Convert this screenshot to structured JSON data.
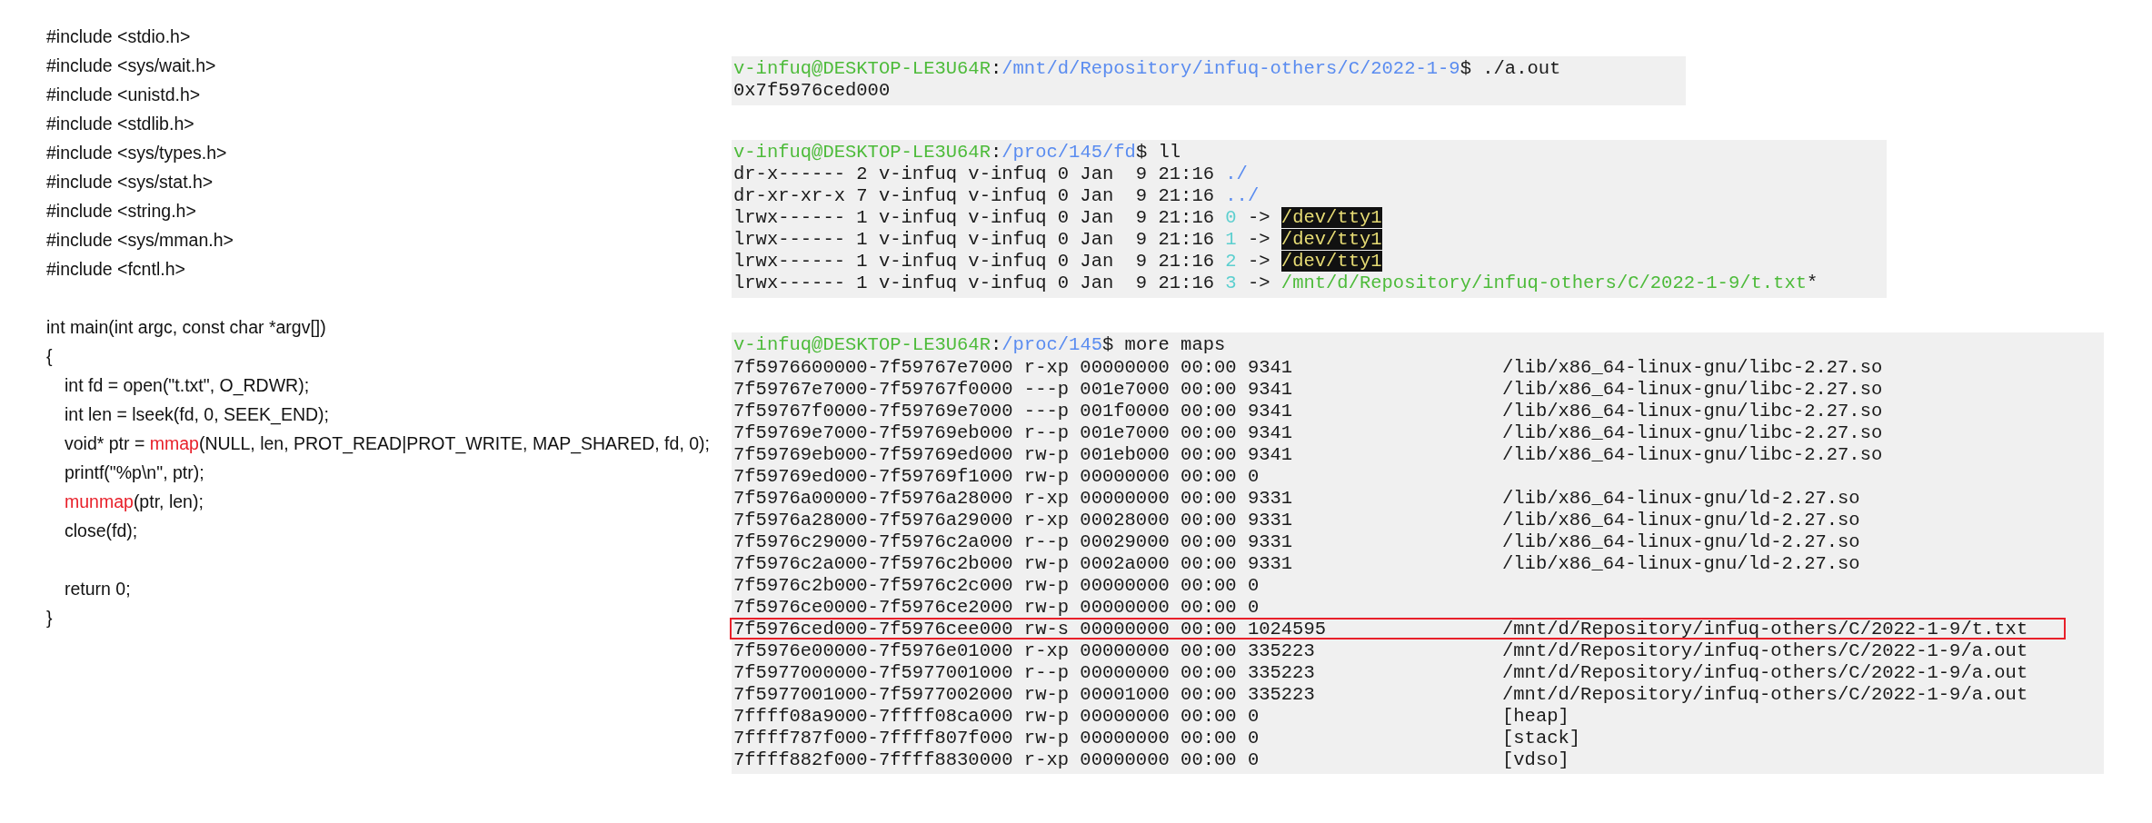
{
  "source_code": {
    "lines": [
      {
        "indented": false,
        "gap_before": false,
        "parts": [
          {
            "kind": "plain",
            "text": "#include <stdio.h>"
          }
        ]
      },
      {
        "indented": false,
        "gap_before": false,
        "parts": [
          {
            "kind": "plain",
            "text": "#include <sys/wait.h>"
          }
        ]
      },
      {
        "indented": false,
        "gap_before": false,
        "parts": [
          {
            "kind": "plain",
            "text": "#include <unistd.h>"
          }
        ]
      },
      {
        "indented": false,
        "gap_before": false,
        "parts": [
          {
            "kind": "plain",
            "text": "#include <stdlib.h>"
          }
        ]
      },
      {
        "indented": false,
        "gap_before": false,
        "parts": [
          {
            "kind": "plain",
            "text": "#include <sys/types.h>"
          }
        ]
      },
      {
        "indented": false,
        "gap_before": false,
        "parts": [
          {
            "kind": "plain",
            "text": "#include <sys/stat.h>"
          }
        ]
      },
      {
        "indented": false,
        "gap_before": false,
        "parts": [
          {
            "kind": "plain",
            "text": "#include <string.h>"
          }
        ]
      },
      {
        "indented": false,
        "gap_before": false,
        "parts": [
          {
            "kind": "plain",
            "text": "#include <sys/mman.h>"
          }
        ]
      },
      {
        "indented": false,
        "gap_before": false,
        "parts": [
          {
            "kind": "plain",
            "text": "#include <fcntl.h>"
          }
        ]
      },
      {
        "indented": false,
        "gap_before": true,
        "parts": [
          {
            "kind": "plain",
            "text": "int main(int argc, const char *argv[])"
          }
        ]
      },
      {
        "indented": false,
        "gap_before": false,
        "parts": [
          {
            "kind": "plain",
            "text": "{"
          }
        ]
      },
      {
        "indented": true,
        "gap_before": false,
        "parts": [
          {
            "kind": "plain",
            "text": "int fd = open(\"t.txt\", O_RDWR);"
          }
        ]
      },
      {
        "indented": true,
        "gap_before": false,
        "parts": [
          {
            "kind": "plain",
            "text": "int len = lseek(fd, 0, SEEK_END);"
          }
        ]
      },
      {
        "indented": true,
        "gap_before": false,
        "parts": [
          {
            "kind": "plain",
            "text": "void* ptr = "
          },
          {
            "kind": "marked",
            "text": "mmap"
          },
          {
            "kind": "plain",
            "text": "(NULL, len, PROT_READ|PROT_WRITE, MAP_SHARED, fd, 0);"
          }
        ]
      },
      {
        "indented": true,
        "gap_before": false,
        "parts": [
          {
            "kind": "plain",
            "text": "printf(\"%p\\n\", ptr);"
          }
        ]
      },
      {
        "indented": true,
        "gap_before": false,
        "parts": [
          {
            "kind": "marked",
            "text": "munmap"
          },
          {
            "kind": "plain",
            "text": "(ptr, len);"
          }
        ]
      },
      {
        "indented": true,
        "gap_before": false,
        "parts": [
          {
            "kind": "plain",
            "text": "close(fd);"
          }
        ]
      },
      {
        "indented": true,
        "gap_before": true,
        "parts": [
          {
            "kind": "plain",
            "text": "return 0;"
          }
        ]
      },
      {
        "indented": false,
        "gap_before": false,
        "parts": [
          {
            "kind": "plain",
            "text": "}"
          }
        ]
      }
    ]
  },
  "terminal_blocks": [
    {
      "lines": [
        [
          {
            "kind": "user",
            "text": "v-infuq@DESKTOP-LE3U64R"
          },
          {
            "kind": "plain",
            "text": ":"
          },
          {
            "kind": "path",
            "text": "/mnt/d/Repository/infuq-others/C/2022-1-9"
          },
          {
            "kind": "plain",
            "text": "$ ./a.out"
          }
        ],
        [
          {
            "kind": "plain",
            "text": "0x7f5976ced000"
          }
        ]
      ]
    },
    {
      "lines": [
        [
          {
            "kind": "user",
            "text": "v-infuq@DESKTOP-LE3U64R"
          },
          {
            "kind": "plain",
            "text": ":"
          },
          {
            "kind": "path",
            "text": "/proc/145/fd"
          },
          {
            "kind": "plain",
            "text": "$ ll"
          }
        ],
        [
          {
            "kind": "plain",
            "text": "dr-x------ 2 v-infuq v-infuq 0 Jan  9 21:16 "
          },
          {
            "kind": "path",
            "text": "./"
          }
        ],
        [
          {
            "kind": "plain",
            "text": "dr-xr-xr-x 7 v-infuq v-infuq 0 Jan  9 21:16 "
          },
          {
            "kind": "path",
            "text": "../"
          }
        ],
        [
          {
            "kind": "plain",
            "text": "lrwx------ 1 v-infuq v-infuq 0 Jan  9 21:16 "
          },
          {
            "kind": "link",
            "text": "0"
          },
          {
            "kind": "plain",
            "text": " -> "
          },
          {
            "kind": "device",
            "text": "/dev/tty1"
          }
        ],
        [
          {
            "kind": "plain",
            "text": "lrwx------ 1 v-infuq v-infuq 0 Jan  9 21:16 "
          },
          {
            "kind": "link",
            "text": "1"
          },
          {
            "kind": "plain",
            "text": " -> "
          },
          {
            "kind": "device",
            "text": "/dev/tty1"
          }
        ],
        [
          {
            "kind": "plain",
            "text": "lrwx------ 1 v-infuq v-infuq 0 Jan  9 21:16 "
          },
          {
            "kind": "link",
            "text": "2"
          },
          {
            "kind": "plain",
            "text": " -> "
          },
          {
            "kind": "device",
            "text": "/dev/tty1"
          }
        ],
        [
          {
            "kind": "plain",
            "text": "lrwx------ 1 v-infuq v-infuq 0 Jan  9 21:16 "
          },
          {
            "kind": "link",
            "text": "3"
          },
          {
            "kind": "plain",
            "text": " -> "
          },
          {
            "kind": "exec",
            "text": "/mnt/d/Repository/infuq-others/C/2022-1-9/t.txt"
          },
          {
            "kind": "plain",
            "text": "*"
          }
        ]
      ]
    },
    {
      "lines": [
        [
          {
            "kind": "user",
            "text": "v-infuq@DESKTOP-LE3U64R"
          },
          {
            "kind": "plain",
            "text": ":"
          },
          {
            "kind": "path",
            "text": "/proc/145"
          },
          {
            "kind": "plain",
            "text": "$ more maps"
          }
        ]
      ],
      "map_rows": [
        {
          "fields": "7f5976600000-7f59767e7000 r-xp 00000000 00:00 9341",
          "path": "/lib/x86_64-linux-gnu/libc-2.27.so",
          "highlighted": false
        },
        {
          "fields": "7f59767e7000-7f59767f0000 ---p 001e7000 00:00 9341",
          "path": "/lib/x86_64-linux-gnu/libc-2.27.so",
          "highlighted": false
        },
        {
          "fields": "7f59767f0000-7f59769e7000 ---p 001f0000 00:00 9341",
          "path": "/lib/x86_64-linux-gnu/libc-2.27.so",
          "highlighted": false
        },
        {
          "fields": "7f59769e7000-7f59769eb000 r--p 001e7000 00:00 9341",
          "path": "/lib/x86_64-linux-gnu/libc-2.27.so",
          "highlighted": false
        },
        {
          "fields": "7f59769eb000-7f59769ed000 rw-p 001eb000 00:00 9341",
          "path": "/lib/x86_64-linux-gnu/libc-2.27.so",
          "highlighted": false
        },
        {
          "fields": "7f59769ed000-7f59769f1000 rw-p 00000000 00:00 0",
          "highlighted": false
        },
        {
          "fields": "7f5976a00000-7f5976a28000 r-xp 00000000 00:00 9331",
          "path": "/lib/x86_64-linux-gnu/ld-2.27.so",
          "highlighted": false
        },
        {
          "fields": "7f5976a28000-7f5976a29000 r-xp 00028000 00:00 9331",
          "path": "/lib/x86_64-linux-gnu/ld-2.27.so",
          "highlighted": false
        },
        {
          "fields": "7f5976c29000-7f5976c2a000 r--p 00029000 00:00 9331",
          "path": "/lib/x86_64-linux-gnu/ld-2.27.so",
          "highlighted": false
        },
        {
          "fields": "7f5976c2a000-7f5976c2b000 rw-p 0002a000 00:00 9331",
          "path": "/lib/x86_64-linux-gnu/ld-2.27.so",
          "highlighted": false
        },
        {
          "fields": "7f5976c2b000-7f5976c2c000 rw-p 00000000 00:00 0",
          "highlighted": false
        },
        {
          "fields": "7f5976ce0000-7f5976ce2000 rw-p 00000000 00:00 0",
          "highlighted": false
        },
        {
          "fields": "7f5976ced000-7f5976cee000 rw-s 00000000 00:00 1024595",
          "path": "/mnt/d/Repository/infuq-others/C/2022-1-9/t.txt",
          "highlighted": true
        },
        {
          "fields": "7f5976e00000-7f5976e01000 r-xp 00000000 00:00 335223",
          "path": "/mnt/d/Repository/infuq-others/C/2022-1-9/a.out",
          "highlighted": false
        },
        {
          "fields": "7f5977000000-7f5977001000 r--p 00000000 00:00 335223",
          "path": "/mnt/d/Repository/infuq-others/C/2022-1-9/a.out",
          "highlighted": false
        },
        {
          "fields": "7f5977001000-7f5977002000 rw-p 00001000 00:00 335223",
          "path": "/mnt/d/Repository/infuq-others/C/2022-1-9/a.out",
          "highlighted": false
        },
        {
          "fields": "7ffff08a9000-7ffff08ca000 rw-p 00000000 00:00 0",
          "path": "[heap]",
          "highlighted": false
        },
        {
          "fields": "7ffff787f000-7ffff807f000 rw-p 00000000 00:00 0",
          "path": "[stack]",
          "highlighted": false
        },
        {
          "fields": "7ffff882f000-7ffff8830000 r-xp 00000000 00:00 0",
          "path": "[vdso]",
          "highlighted": false
        }
      ]
    }
  ]
}
